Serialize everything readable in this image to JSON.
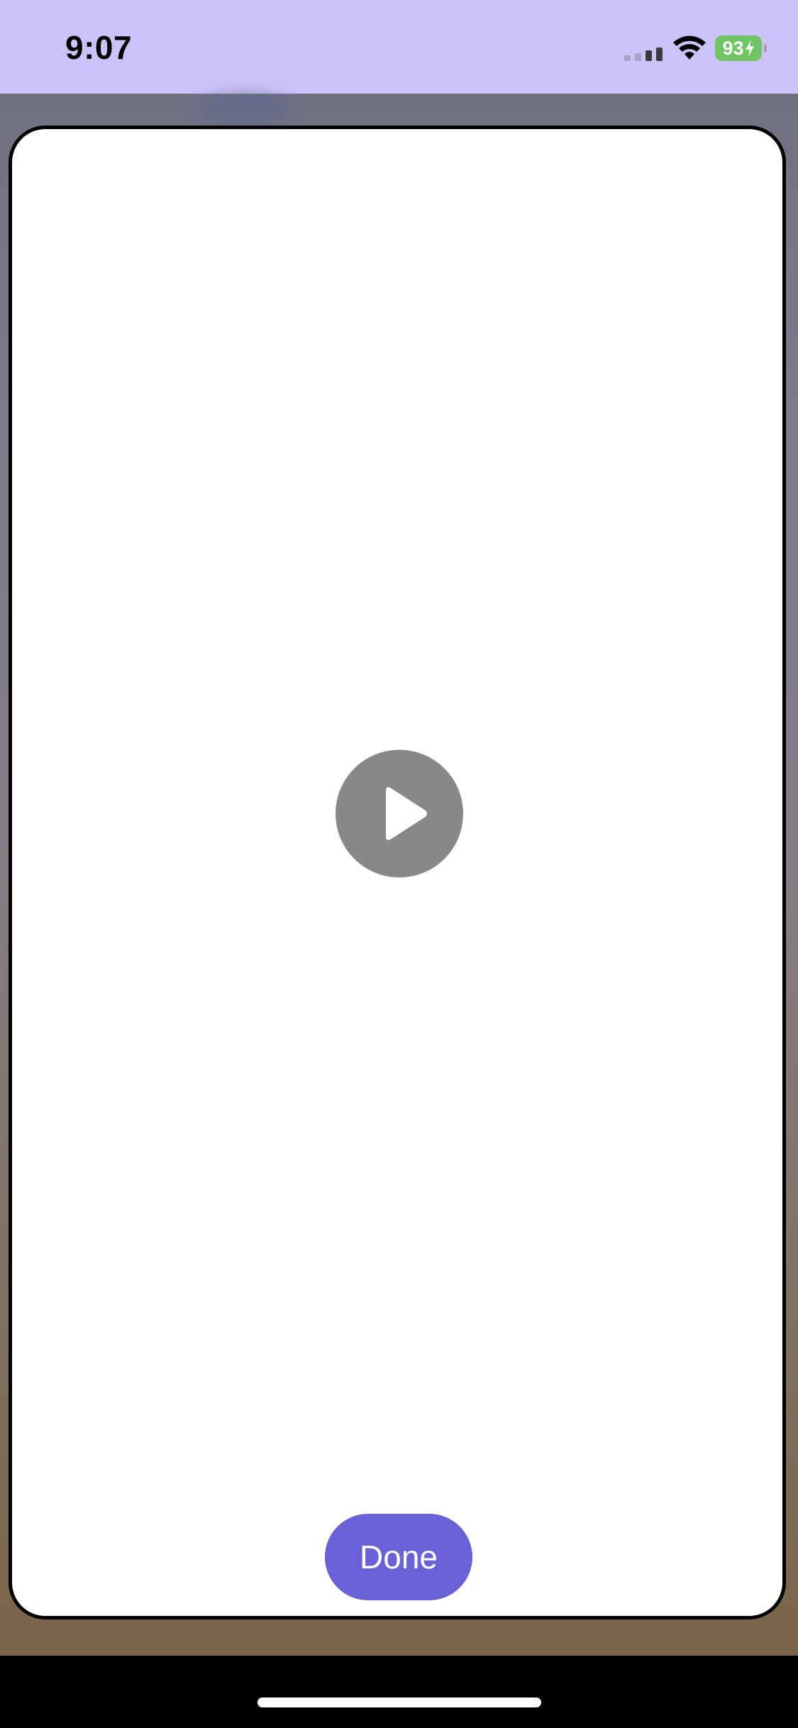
{
  "status_bar": {
    "time": "9:07",
    "battery_level": "93",
    "battery_charging": true,
    "signal_icon": "cellular-signal-icon",
    "wifi_icon": "wifi-icon",
    "battery_icon": "battery-charging-icon",
    "battery_color": "#6fc463",
    "background_color": "#cdc2f7"
  },
  "modal": {
    "play_icon": "play-icon",
    "done_label": "Done",
    "accent_color": "#6961d6"
  }
}
